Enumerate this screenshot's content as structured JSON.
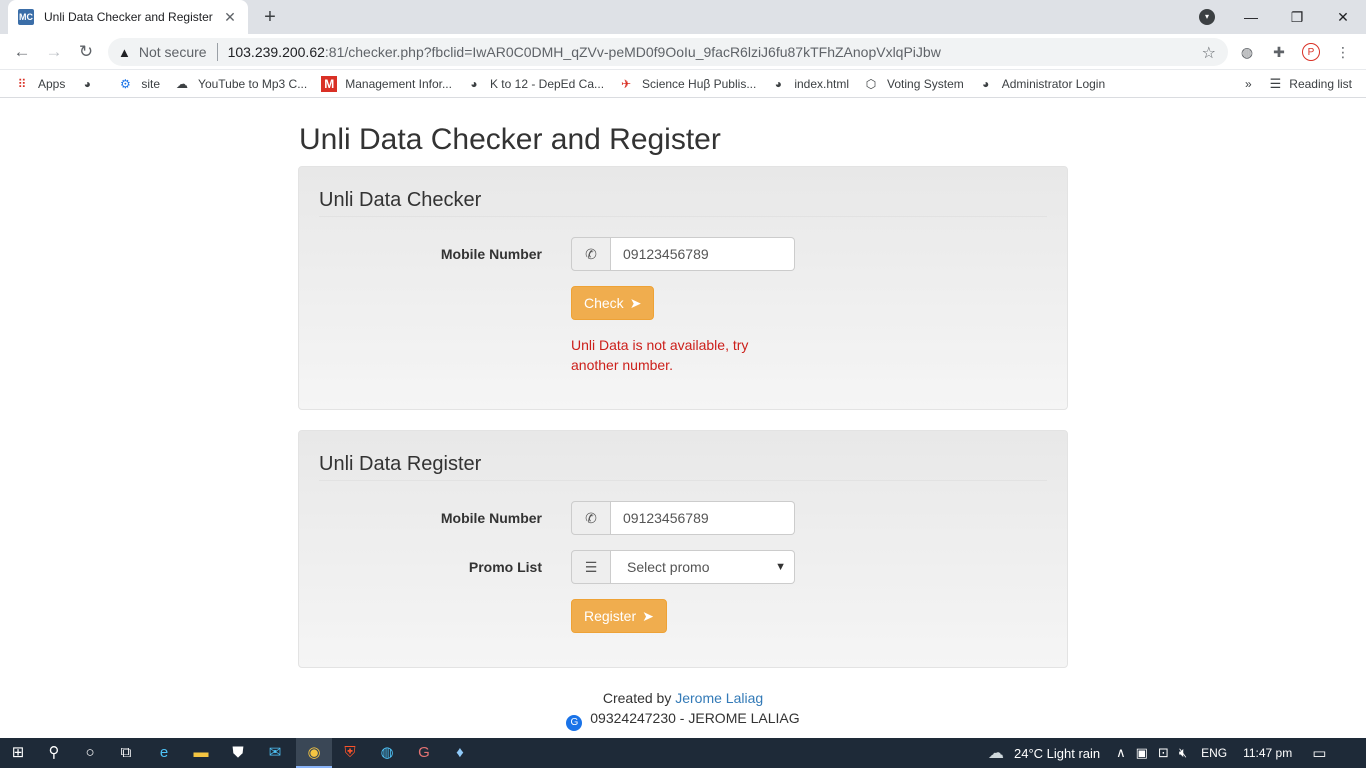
{
  "browser": {
    "tab_title": "Unli Data Checker and Register",
    "tab_favicon_text": "MC",
    "not_secure": "Not secure",
    "url_host": "103.239.200.62",
    "url_rest": ":81/checker.php?fbclid=IwAR0C0DMH_qZVv-peMD0f9OoIu_9facR6lziJ6fu87kTFhZAnopVxlqPiJbw",
    "bookmarks": [
      {
        "label": "Apps",
        "icon": "apps-grid-icon"
      },
      {
        "label": "",
        "icon": "globe-icon"
      },
      {
        "label": "site",
        "icon": "gear-icon"
      },
      {
        "label": "YouTube to Mp3 C...",
        "icon": "download-cloud-icon"
      },
      {
        "label": "Management Infor...",
        "icon": "m-logo-icon"
      },
      {
        "label": "K to 12 - DepEd Ca...",
        "icon": "globe-icon"
      },
      {
        "label": "Science Huβ Publis...",
        "icon": "bird-icon"
      },
      {
        "label": "index.html",
        "icon": "globe-icon"
      },
      {
        "label": "Voting System",
        "icon": "shield-icon"
      },
      {
        "label": "Administrator Login",
        "icon": "globe-icon"
      }
    ],
    "more_bookmarks": "»",
    "reading_list": "Reading list"
  },
  "page": {
    "title": "Unli Data Checker and Register",
    "checker": {
      "heading": "Unli Data Checker",
      "mobile_label": "Mobile Number",
      "mobile_value": "09123456789",
      "check_button": "Check",
      "error_message": "Unli Data is not available, try another number."
    },
    "register": {
      "heading": "Unli Data Register",
      "mobile_label": "Mobile Number",
      "mobile_value": "09123456789",
      "promo_label": "Promo List",
      "promo_selected": "Select promo",
      "register_button": "Register"
    },
    "footer": {
      "created_by": "Created by",
      "author_link": "Jerome Laliag",
      "contact": "09324247230 - JEROME LALIAG"
    }
  },
  "taskbar": {
    "weather": "24°C  Light rain",
    "lang": "ENG",
    "time": "11:47 pm"
  },
  "colors": {
    "warning_button": "#f0ad4e",
    "error_text": "#cc1f1a",
    "link": "#337ab7"
  }
}
